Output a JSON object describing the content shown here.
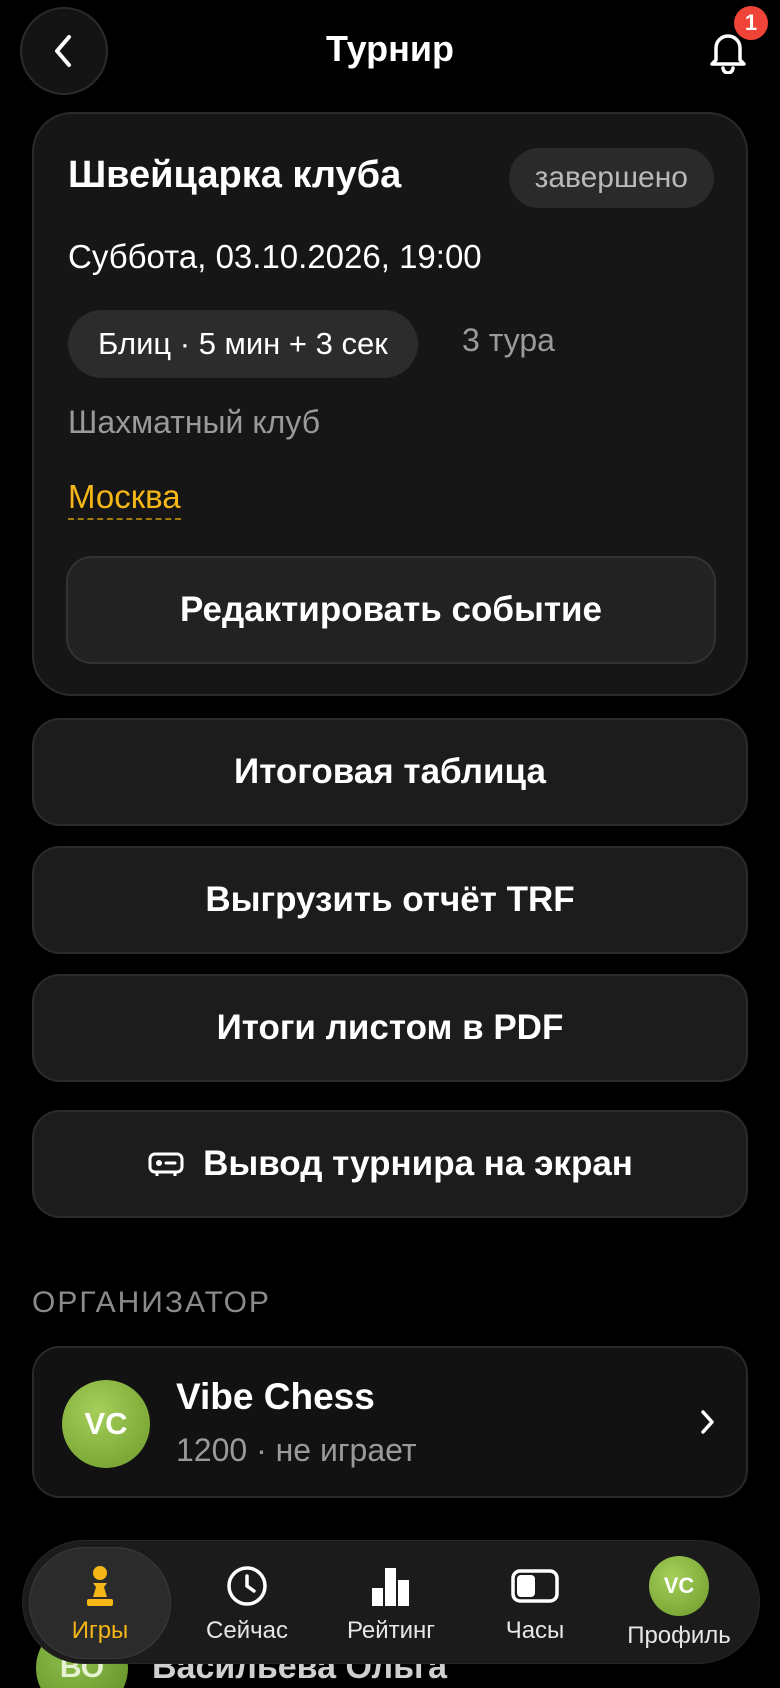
{
  "header": {
    "title": "Турнир",
    "notification_count": "1"
  },
  "event": {
    "title": "Швейцарка клуба",
    "status": "завершено",
    "date": "Суббота, 03.10.2026, 19:00",
    "format": "Блиц · 5 мин + 3 сек",
    "rounds": "3 тура",
    "club": "Шахматный клуб",
    "city": "Москва",
    "edit_label": "Редактировать событие"
  },
  "actions": {
    "final_table": "Итоговая таблица",
    "export_trf": "Выгрузить отчёт TRF",
    "pdf_results": "Итоги листом в PDF",
    "screen_output": "Вывод турнира на экран"
  },
  "organizer": {
    "section_label": "ОРГАНИЗАТОР",
    "initials": "VC",
    "name": "Vibe Chess",
    "subtitle": "1200 · не играет"
  },
  "peek_row": {
    "initials": "ВО",
    "name": "Васильева Ольга"
  },
  "nav": {
    "items": [
      {
        "label": "Игры",
        "icon": "pawn-icon",
        "active": true
      },
      {
        "label": "Сейчас",
        "icon": "clock-icon"
      },
      {
        "label": "Рейтинг",
        "icon": "bar-chart-icon"
      },
      {
        "label": "Часы",
        "icon": "chess-clock-icon"
      },
      {
        "label": "Профиль",
        "icon": "avatar",
        "initials": "VC"
      }
    ]
  },
  "colors": {
    "accent": "#f5b617",
    "badge": "#f04438",
    "avatar_green": "#8fb843"
  }
}
